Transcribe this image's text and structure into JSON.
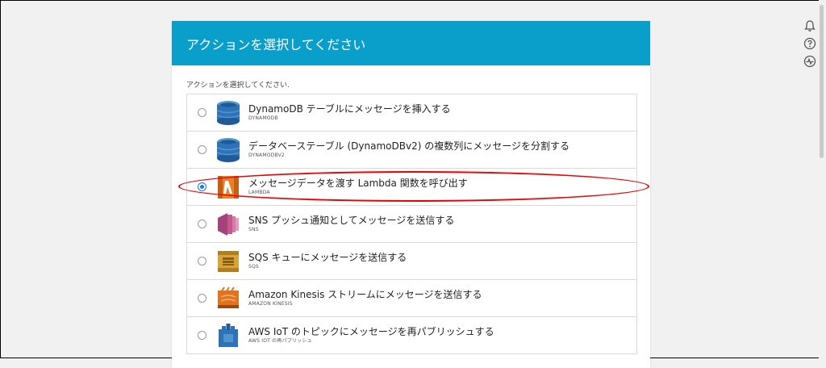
{
  "dialog": {
    "title": "アクションを選択してください",
    "instruction": "アクションを選択してください."
  },
  "actions": [
    {
      "label": "DynamoDB テーブルにメッセージを挿入する",
      "sub": "DYNAMODB",
      "icon": "dynamodb-icon",
      "color": "#2e73b8",
      "selected": false
    },
    {
      "label": "データベーステーブル (DynamoDBv2) の複数列にメッセージを分割する",
      "sub": "DYNAMODBV2",
      "icon": "dynamodb-icon",
      "color": "#2e73b8",
      "selected": false
    },
    {
      "label": "メッセージデータを渡す Lambda 関数を呼び出す",
      "sub": "LAMBDA",
      "icon": "lambda-icon",
      "color": "#e7822b",
      "selected": true
    },
    {
      "label": "SNS プッシュ通知としてメッセージを送信する",
      "sub": "SNS",
      "icon": "sns-icon",
      "color": "#c7578f",
      "selected": false
    },
    {
      "label": "SQS キューにメッセージを送信する",
      "sub": "SQS",
      "icon": "sqs-icon",
      "color": "#d6a43a",
      "selected": false
    },
    {
      "label": "Amazon Kinesis ストリームにメッセージを送信する",
      "sub": "AMAZON KINESIS",
      "icon": "kinesis-icon",
      "color": "#e0741e",
      "selected": false
    },
    {
      "label": "AWS IoT のトピックにメッセージを再パブリッシュする",
      "sub": "AWS IOT の再パブリッシュ",
      "icon": "iot-icon",
      "color": "#2e73b8",
      "selected": false
    }
  ],
  "toolbar_icons": [
    "bell-icon",
    "help-icon",
    "activity-icon"
  ]
}
